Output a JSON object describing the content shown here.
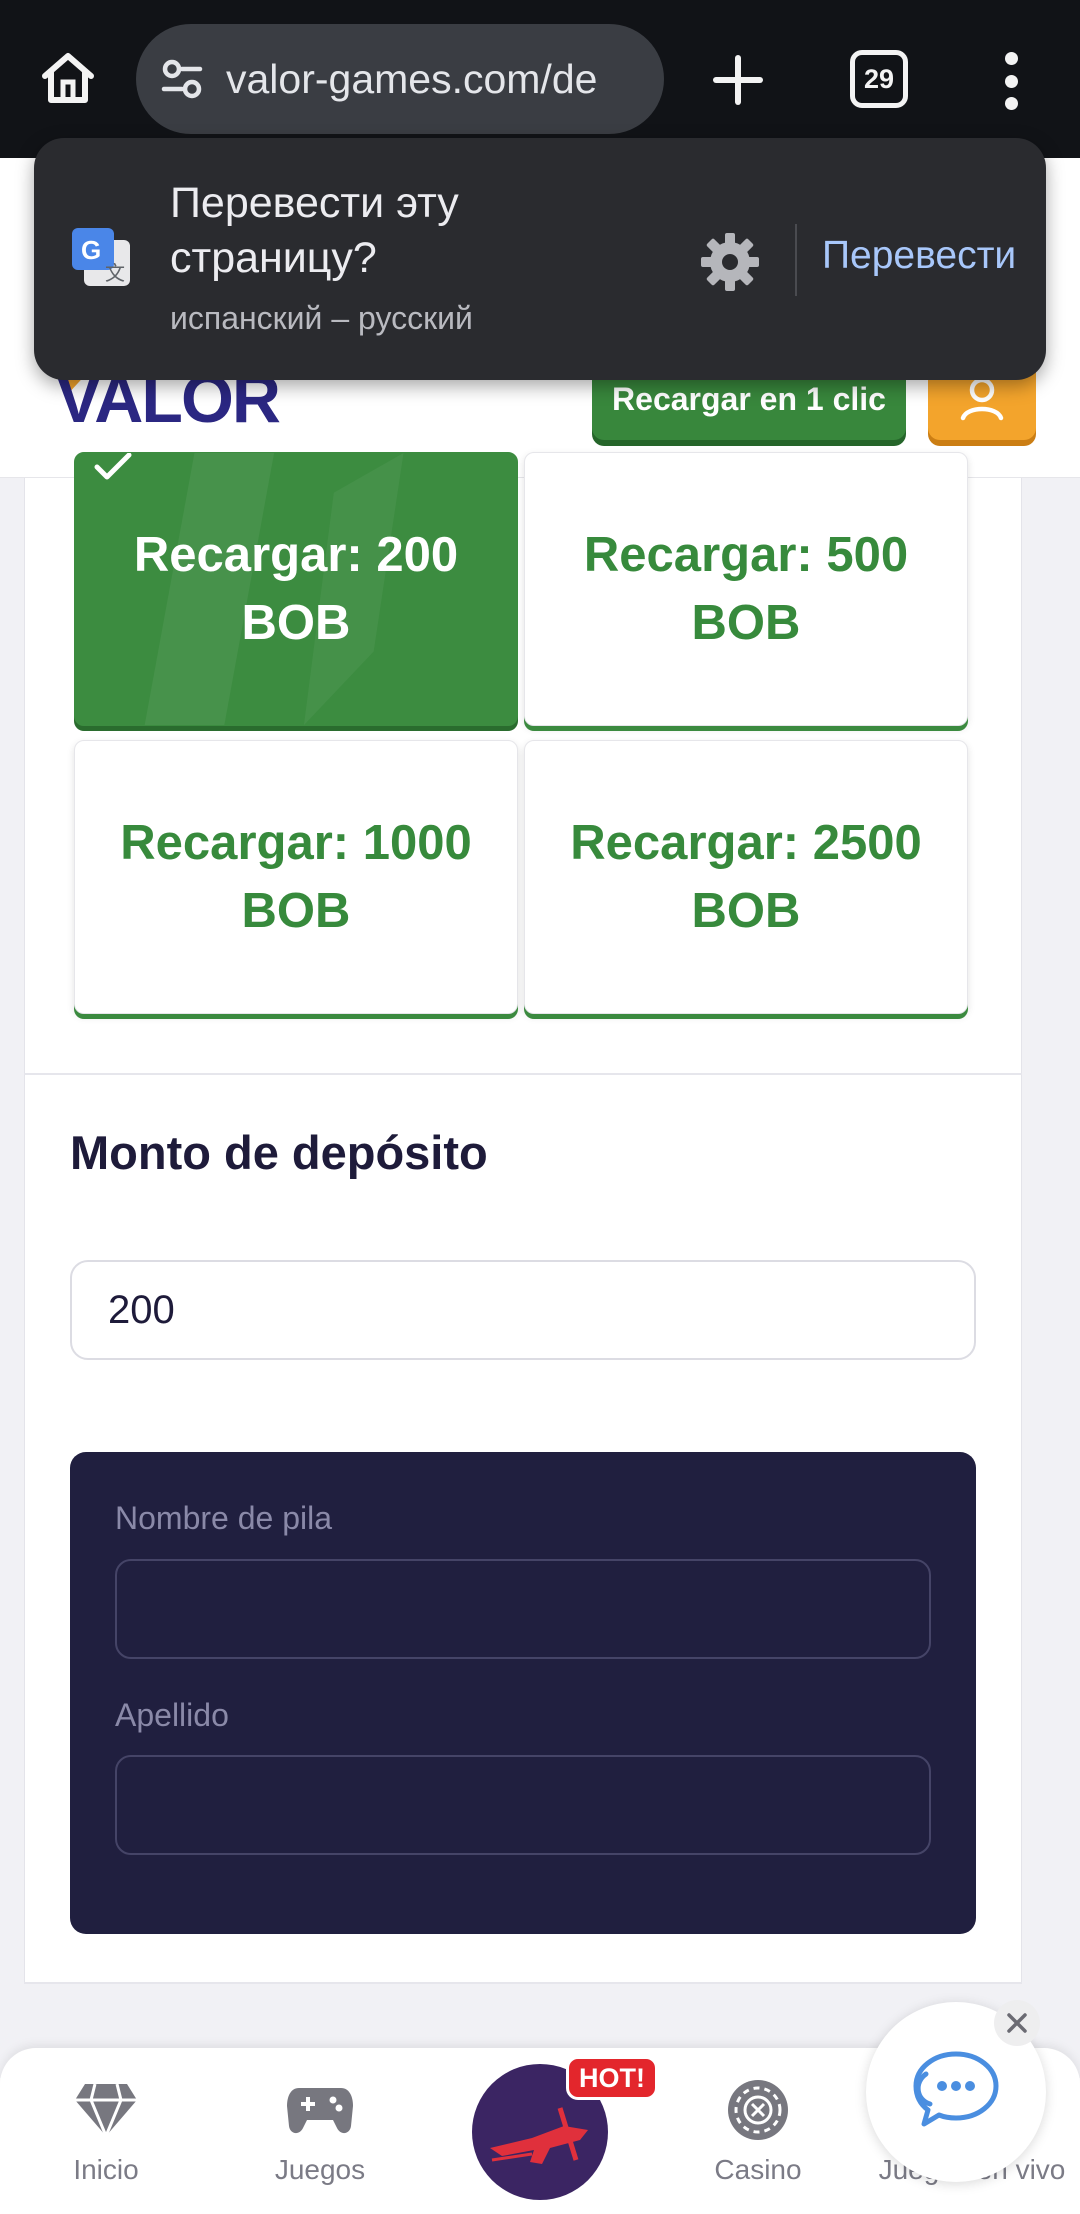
{
  "browser": {
    "url": "valor-games.com/de",
    "tab_count": "29"
  },
  "translate_popup": {
    "title": "Перевести эту страницу?",
    "languages": "испанский – русский",
    "action": "Перевести"
  },
  "header": {
    "logo_text": "VALOR",
    "reload_button": "Recargar en 1 clic"
  },
  "amount_options": [
    {
      "label": "Recargar: 200 BOB",
      "selected": true
    },
    {
      "label": "Recargar: 500 BOB",
      "selected": false
    },
    {
      "label": "Recargar: 1000 BOB",
      "selected": false
    },
    {
      "label": "Recargar: 2500 BOB",
      "selected": false
    }
  ],
  "deposit": {
    "title": "Monto de depósito",
    "amount_value": "200"
  },
  "form": {
    "first_name_label": "Nombre de pila",
    "first_name_value": "",
    "last_name_label": "Apellido",
    "last_name_value": ""
  },
  "bottom_nav": {
    "items": [
      {
        "label": "Inicio",
        "icon": "diamond-icon"
      },
      {
        "label": "Juegos",
        "icon": "gamepad-icon"
      },
      {
        "label": "",
        "icon": "aviator-plane-icon"
      },
      {
        "label": "Casino",
        "icon": "roulette-chip-icon"
      },
      {
        "label": "Juegos en vivo",
        "icon": "live-games-icon"
      }
    ],
    "hot_badge": "HOT!"
  },
  "colors": {
    "brand_green": "#3c8c40",
    "brand_orange": "#f3a42c",
    "brand_navy": "#201f3f",
    "chrome_dark": "#111317",
    "link_blue": "#a8c7fa",
    "hot_red": "#e3262c"
  }
}
